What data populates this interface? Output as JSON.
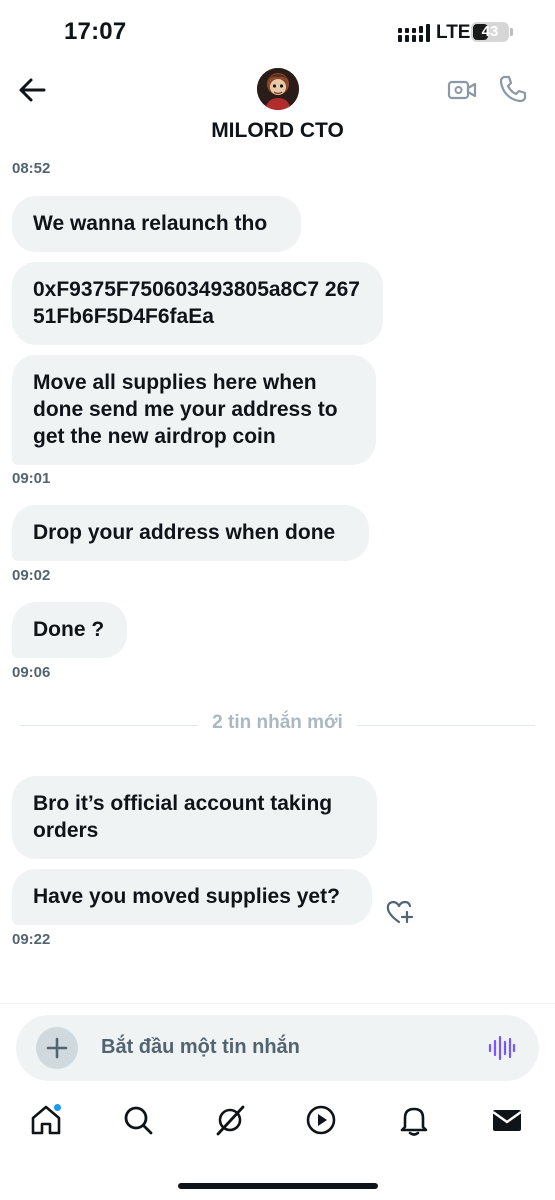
{
  "status_bar": {
    "time": "17:07",
    "network": "LTE",
    "battery": "43",
    "battery_level": 0.43
  },
  "header": {
    "back_icon": "arrow-left-icon",
    "contact_name": "MILORD CTO",
    "video_icon": "video-camera-icon",
    "call_icon": "phone-icon"
  },
  "messages": {
    "ts1": "08:52",
    "m1": "We wanna relaunch tho",
    "m2": "0xF9375F750603493805a8C7 26751Fb6F5D4F6faEa",
    "m3": "Move all supplies here when done send me your address to get the new airdrop coin",
    "ts2": "09:01",
    "m4": "Drop your address when done",
    "ts3": "09:02",
    "m5": "Done ?",
    "ts4": "09:06",
    "m6": "Bro it’s official account taking orders",
    "m7": "Have you moved supplies yet?",
    "ts5": "09:22"
  },
  "divider": {
    "label": "2 tin nhắn mới"
  },
  "composer": {
    "placeholder": "Bắt đầu một tin nhắn",
    "add_icon": "plus-icon",
    "voice_icon": "voice-waveform-icon"
  },
  "nav": {
    "items": [
      "home-icon",
      "search-icon",
      "grok-icon",
      "video-play-icon",
      "bell-icon",
      "mail-icon"
    ],
    "home_has_notification": true
  },
  "colors": {
    "bubble": "#eff3f4",
    "text": "#0f1419",
    "muted": "#536471",
    "accent": "#1d9bf0",
    "voice": "#7856ff"
  }
}
